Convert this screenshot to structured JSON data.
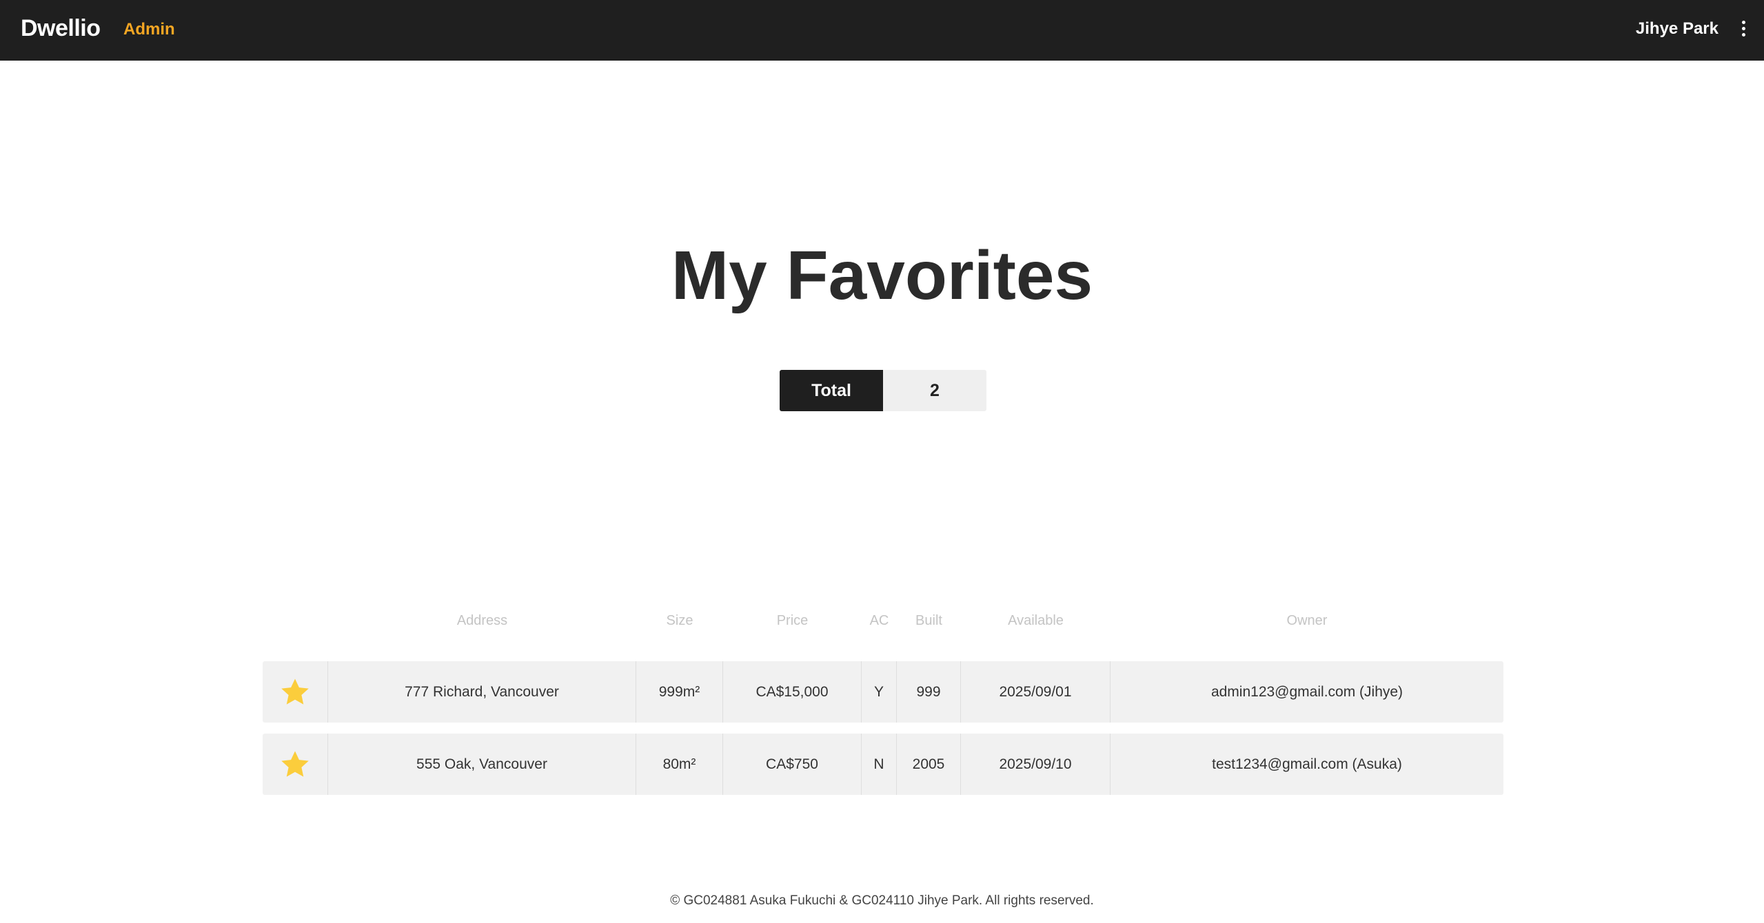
{
  "header": {
    "brand": "Dwellio",
    "admin_label": "Admin",
    "user_name": "Jihye Park",
    "menu_icon": "kebab-menu-icon"
  },
  "main": {
    "title": "My Favorites",
    "total": {
      "label": "Total",
      "count": "2"
    }
  },
  "table": {
    "columns": [
      "",
      "Address",
      "Size",
      "Price",
      "AC",
      "Built",
      "Available",
      "Owner"
    ],
    "rows": [
      {
        "favorite_icon": "star-icon",
        "address": "777 Richard, Vancouver",
        "size": "999m²",
        "price": "CA$15,000",
        "ac": "Y",
        "built": "999",
        "available": "2025/09/01",
        "owner": "admin123@gmail.com (Jihye)"
      },
      {
        "favorite_icon": "star-icon",
        "address": "555 Oak, Vancouver",
        "size": "80m²",
        "price": "CA$750",
        "ac": "N",
        "built": "2005",
        "available": "2025/09/10",
        "owner": "test1234@gmail.com (Asuka)"
      }
    ]
  },
  "footer": {
    "text": "© GC024881 Asuka Fukuchi & GC024110 Jihye Park. All rights reserved."
  },
  "colors": {
    "topbar": "#1f1f1f",
    "accent": "#f5a623",
    "star": "#fbcd3c",
    "row_bg": "#f1f1f1"
  }
}
